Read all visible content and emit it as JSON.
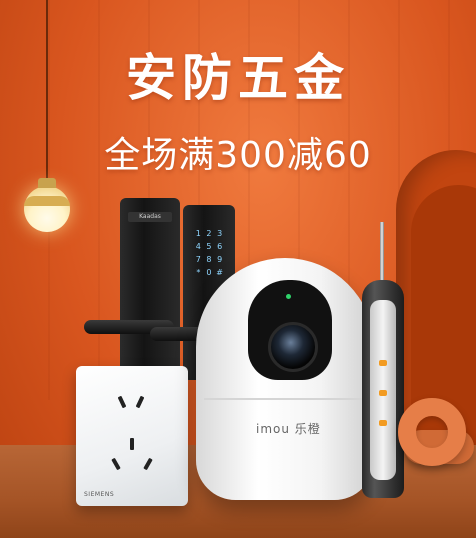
{
  "banner": {
    "headline": "安防五金",
    "promo": "全场满300减60"
  },
  "products": {
    "lock_brand": "Kaadas",
    "keypad_keys": [
      "1",
      "2",
      "3",
      "4",
      "5",
      "6",
      "7",
      "8",
      "9",
      "*",
      "0",
      "#"
    ],
    "camera_brand": "imou 乐橙",
    "socket_brand": "SIEMENS"
  },
  "colors": {
    "background": "#d9561f",
    "headline_text": "#ffffff",
    "floor": "#a55426"
  }
}
